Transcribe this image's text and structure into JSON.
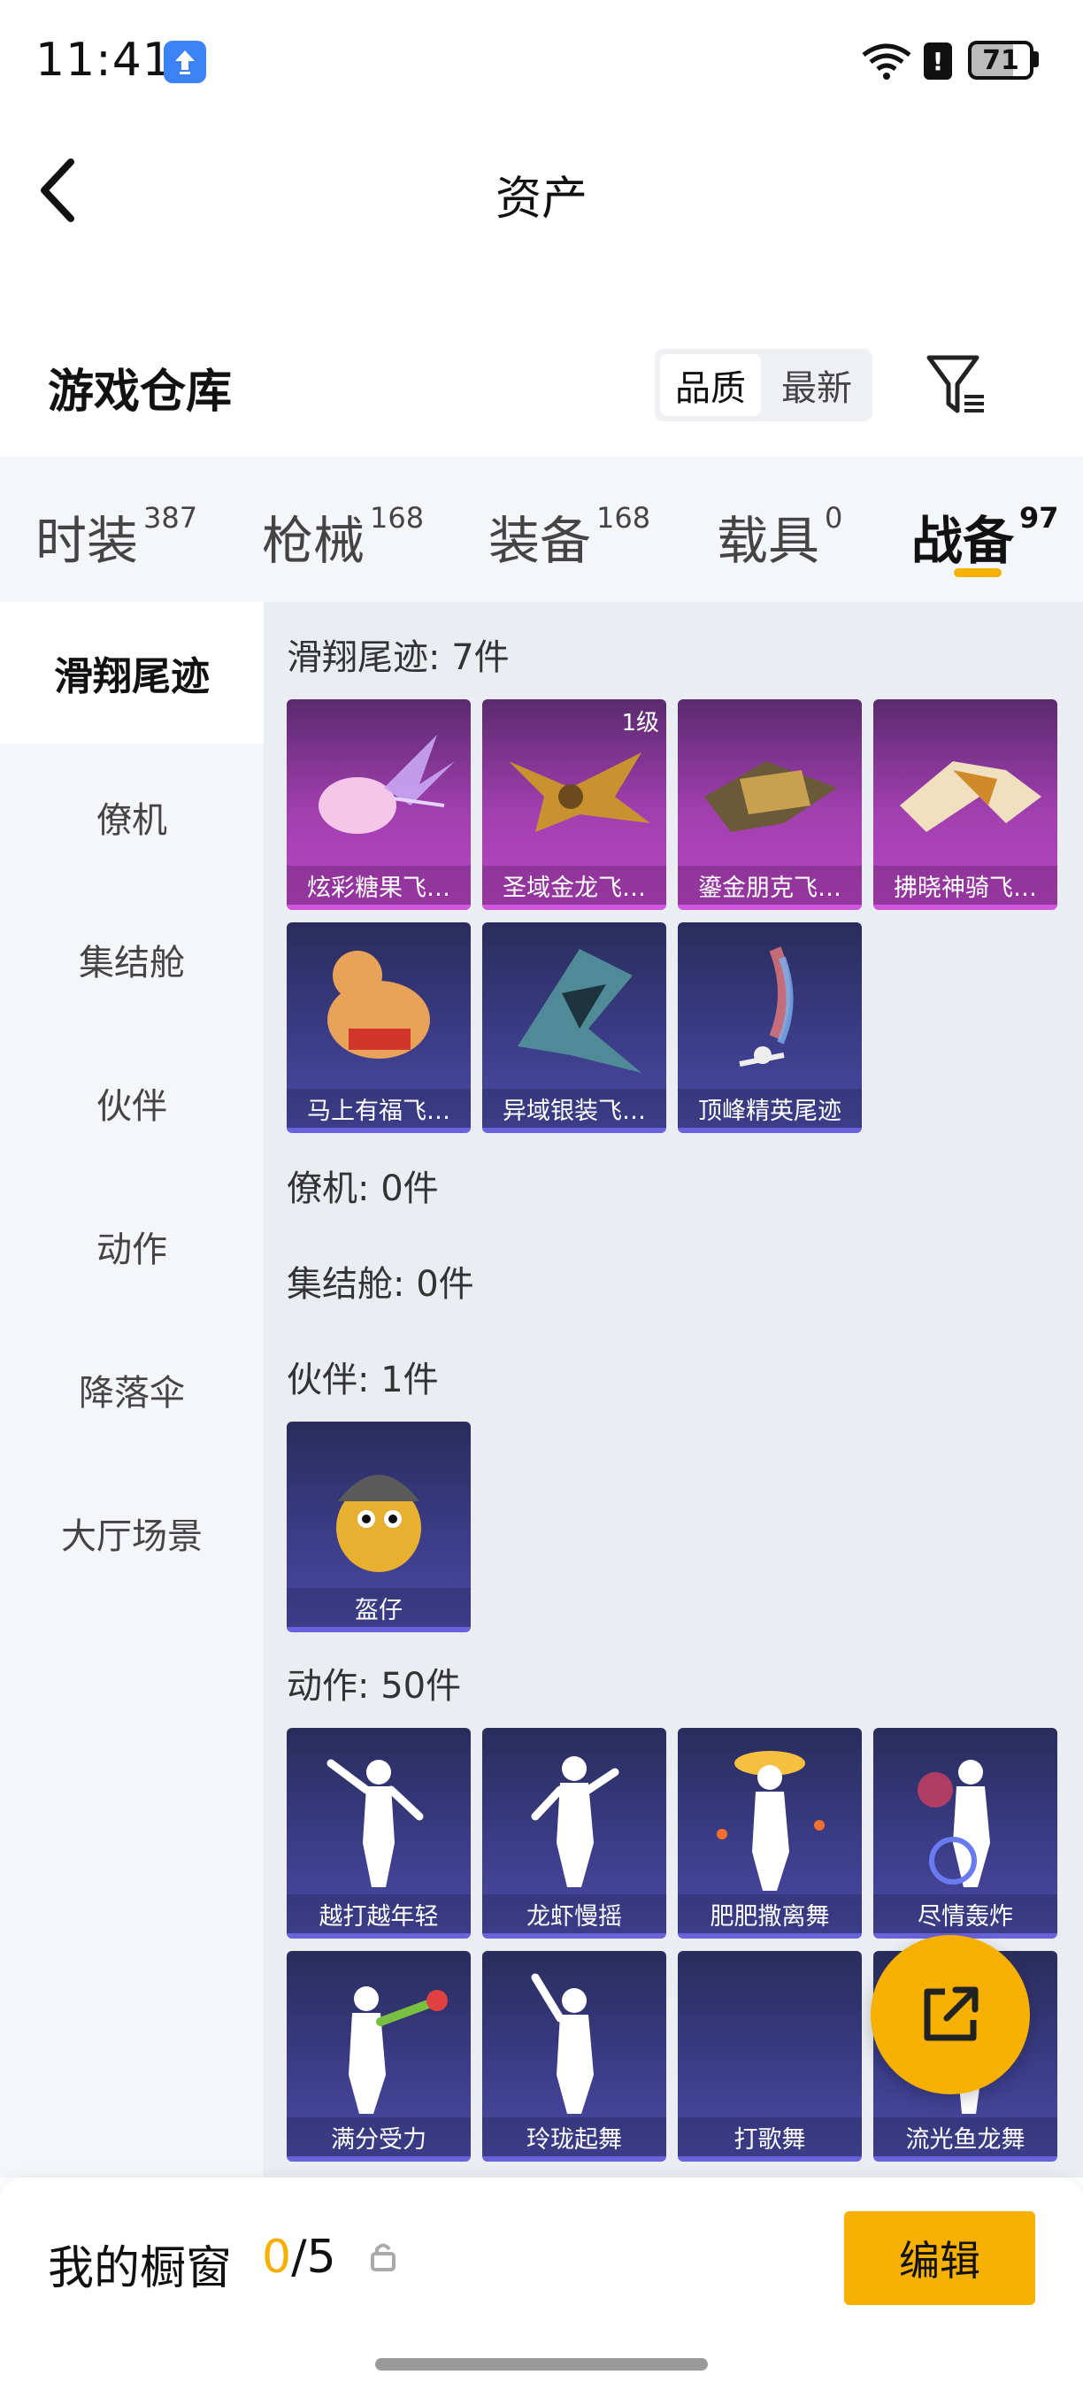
{
  "status_bar": {
    "time": "11:41",
    "battery": "71"
  },
  "header": {
    "title": "资产",
    "back_icon": "chevron-left-icon"
  },
  "warehouse": {
    "title": "游戏仓库",
    "sort_options": [
      "品质",
      "最新"
    ],
    "selected_sort": "品质",
    "filter_icon": "filter-icon"
  },
  "tabs": [
    {
      "label": "时装",
      "count": "387"
    },
    {
      "label": "枪械",
      "count": "168"
    },
    {
      "label": "装备",
      "count": "168"
    },
    {
      "label": "载具",
      "count": "0"
    },
    {
      "label": "战备",
      "count": "97",
      "active": true
    }
  ],
  "side_nav": [
    "滑翔尾迹",
    "僚机",
    "集结舱",
    "伙伴",
    "动作",
    "降落伞",
    "大厅场景"
  ],
  "sections": {
    "glide": {
      "title": "滑翔尾迹: 7件",
      "items": [
        {
          "label": "炫彩糖果飞…",
          "rarity": "purple"
        },
        {
          "label": "圣域金龙飞…",
          "rarity": "purple",
          "badge": "1级"
        },
        {
          "label": "鎏金朋克飞…",
          "rarity": "purple"
        },
        {
          "label": "拂晓神骑飞…",
          "rarity": "purple"
        },
        {
          "label": "马上有福飞…",
          "rarity": "blue"
        },
        {
          "label": "异域银装飞…",
          "rarity": "blue"
        },
        {
          "label": "顶峰精英尾迹",
          "rarity": "blue"
        }
      ]
    },
    "wingman": {
      "title": "僚机: 0件"
    },
    "capsule": {
      "title": "集结舱: 0件"
    },
    "partner": {
      "title": "伙伴: 1件",
      "items": [
        {
          "label": "盔仔",
          "rarity": "blue"
        }
      ]
    },
    "emote": {
      "title": "动作: 50件",
      "items": [
        {
          "label": "越打越年轻",
          "rarity": "blue"
        },
        {
          "label": "龙虾慢摇",
          "rarity": "blue"
        },
        {
          "label": "肥肥撒离舞",
          "rarity": "blue"
        },
        {
          "label": "尽情轰炸",
          "rarity": "blue"
        },
        {
          "label": "满分受力",
          "rarity": "blue"
        },
        {
          "label": "玲珑起舞",
          "rarity": "blue"
        },
        {
          "label": "打歌舞",
          "rarity": "blue"
        },
        {
          "label": "流光鱼龙舞",
          "rarity": "blue"
        }
      ]
    }
  },
  "fab": {
    "icon": "share-icon"
  },
  "showcase": {
    "label": "我的橱窗",
    "current": "0",
    "total": "/5",
    "lock_icon": "lock-icon"
  },
  "edit_button": "编辑",
  "colors": {
    "accent": "#f5b000",
    "purple_card": "#a23fb0",
    "blue_card": "#3a3c86"
  }
}
